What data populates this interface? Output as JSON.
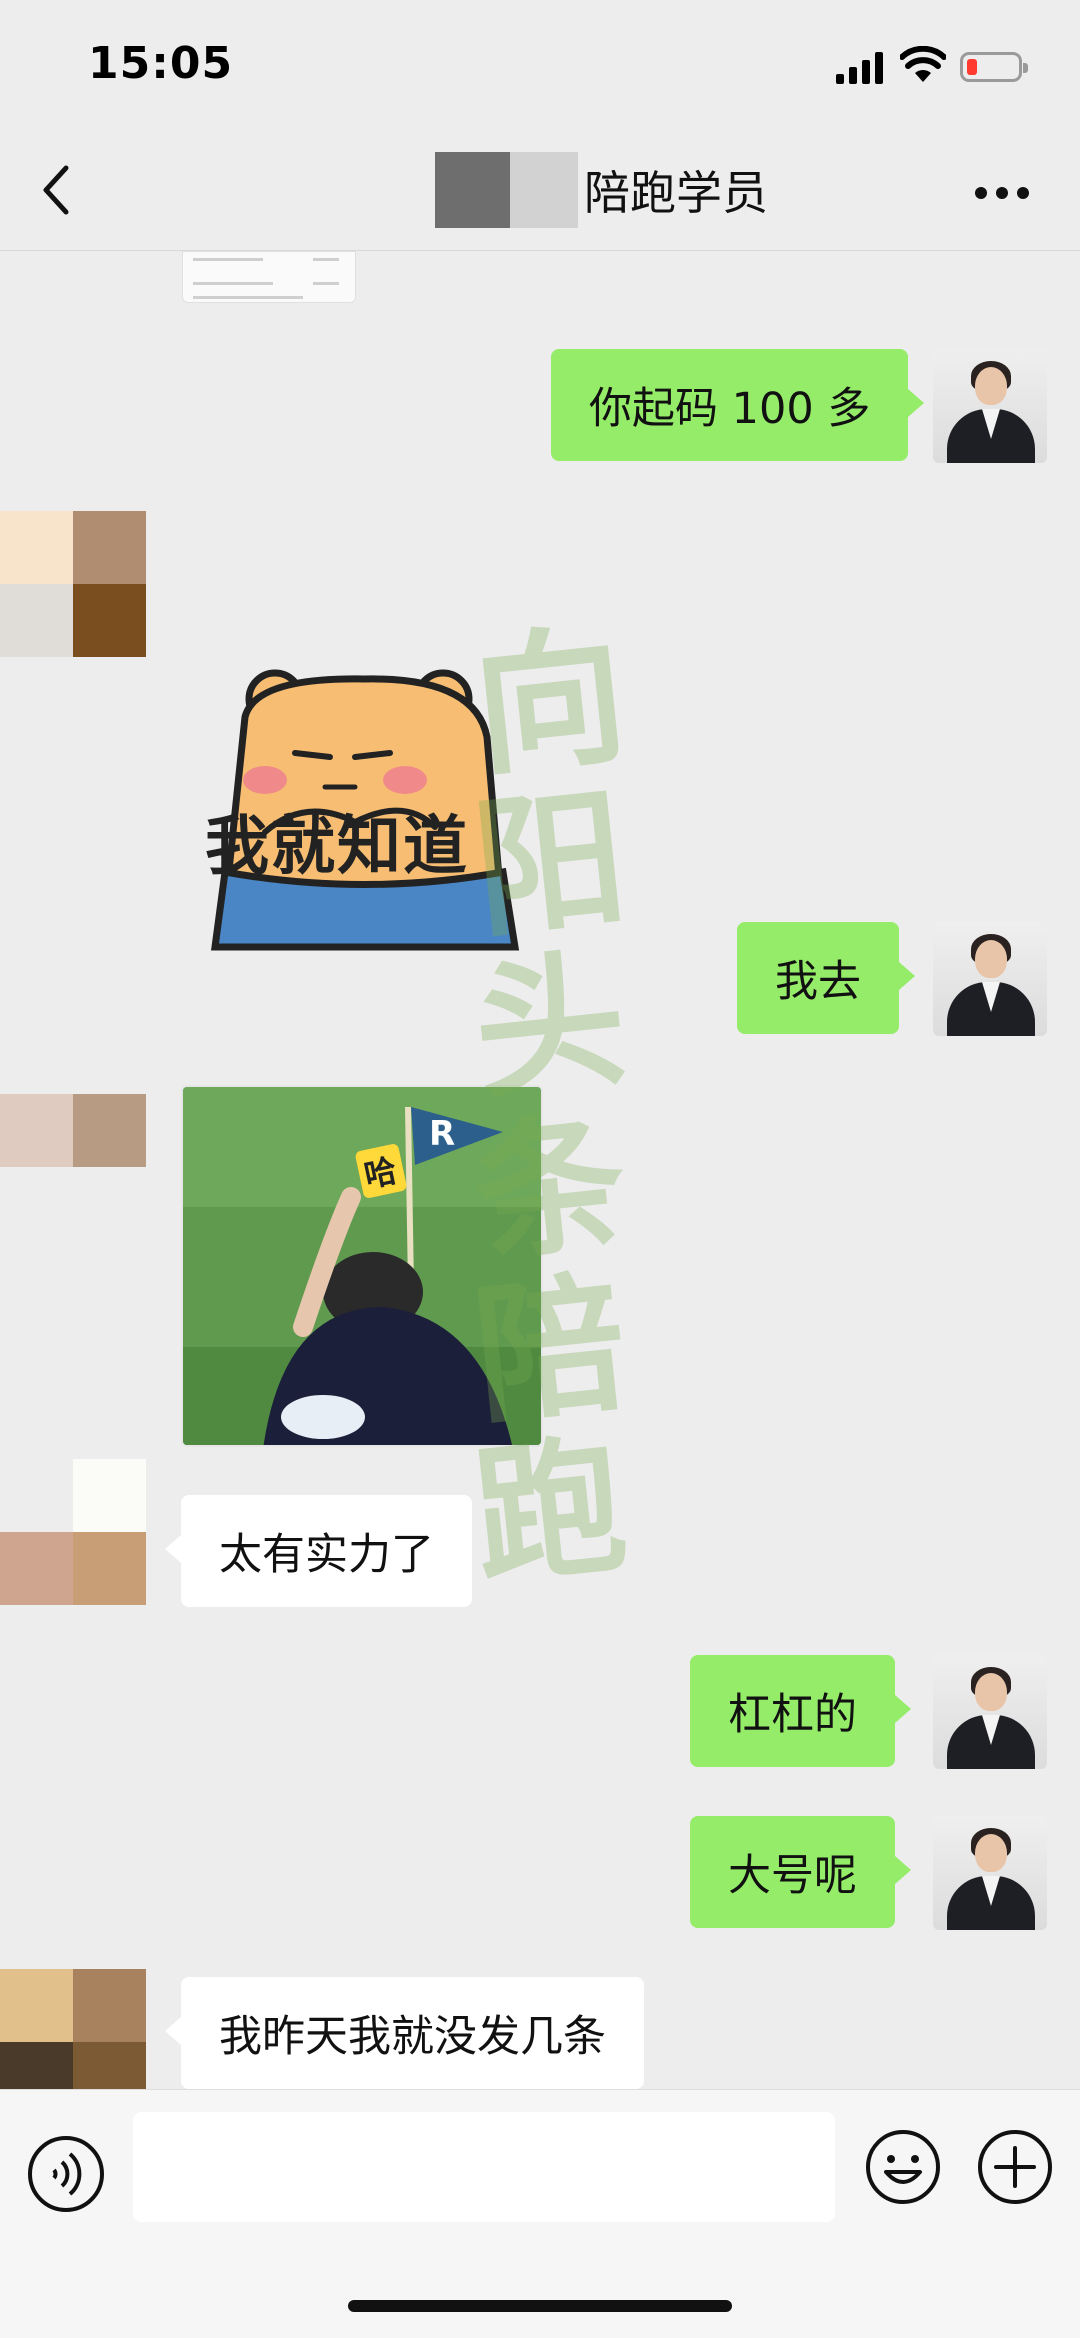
{
  "status_bar": {
    "time": "15:05",
    "battery_color": "#ff3b30"
  },
  "header": {
    "title": "陪跑学员",
    "back_icon": "chevron-left-icon",
    "more_icon": "more-dots-icon"
  },
  "messages": [
    {
      "from": "me",
      "text": "你起码 100 多"
    },
    {
      "from": "other",
      "type": "sticker",
      "caption": "我就知道"
    },
    {
      "from": "me",
      "text": "我去"
    },
    {
      "from": "other",
      "type": "image",
      "flag_text": "R",
      "sign_text": "哈"
    },
    {
      "from": "other",
      "text": "太有实力了"
    },
    {
      "from": "me",
      "text": "杠杠的"
    },
    {
      "from": "me",
      "text": "大号呢"
    },
    {
      "from": "other",
      "text": "我昨天我就没发几条"
    }
  ],
  "watermark": [
    "向",
    "阳",
    "头",
    "条",
    "陪",
    "跑"
  ],
  "input_bar": {
    "voice_icon": "voice-icon",
    "emoji_icon": "emoji-icon",
    "plus_icon": "plus-icon",
    "text_value": ""
  },
  "colors": {
    "me_bubble": "#95ec69",
    "other_bubble": "#ffffff",
    "background": "#ededed"
  }
}
